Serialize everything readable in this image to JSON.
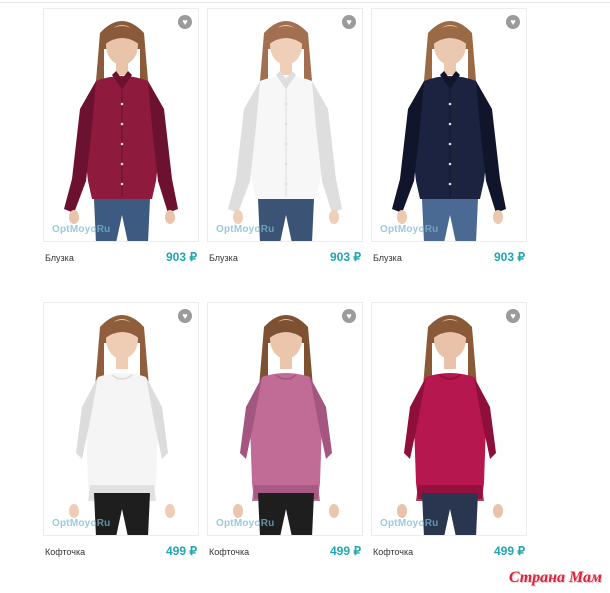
{
  "products": [
    {
      "name": "Блузка",
      "price": "903 ₽",
      "watermark": "OptMoyoRu",
      "garment": "shirt",
      "color": "#8e1a3d",
      "shade": "#6c1230",
      "pants": "#3d5a80",
      "skin": "#e9c4ab",
      "hair": "#8a5a3a"
    },
    {
      "name": "Блузка",
      "price": "903 ₽",
      "watermark": "OptMoyoRu",
      "garment": "shirt",
      "color": "#f7f7f7",
      "shade": "#dedede",
      "pants": "#3b5475",
      "skin": "#efcfb8",
      "hair": "#a27050"
    },
    {
      "name": "Блузка",
      "price": "903 ₽",
      "watermark": "OptMoyoRu",
      "garment": "shirt",
      "color": "#1c2340",
      "shade": "#10152b",
      "pants": "#4a6a93",
      "skin": "#ebc8b0",
      "hair": "#9a6a45"
    },
    {
      "name": "Кофточка",
      "price": "499 ₽",
      "watermark": "OptMoyoRu",
      "garment": "top",
      "color": "#f5f5f5",
      "shade": "#dcdcdc",
      "pants": "#1e1e1e",
      "skin": "#efccb4",
      "hair": "#8f5e3c"
    },
    {
      "name": "Кофточка",
      "price": "499 ₽",
      "watermark": "OptMoyoRu",
      "garment": "top",
      "color": "#c16b97",
      "shade": "#a25680",
      "pants": "#1e1e1e",
      "skin": "#ebc6ad",
      "hair": "#7e5132"
    },
    {
      "name": "Кофточка",
      "price": "499 ₽",
      "watermark": "OptMoyoRu",
      "garment": "top",
      "color": "#b5174e",
      "shade": "#8f0f3b",
      "pants": "#2a3550",
      "skin": "#e9c2a9",
      "hair": "#8a5a38"
    }
  ],
  "brand_logo": "Страна Мам",
  "favorite_icon": "heart-icon"
}
